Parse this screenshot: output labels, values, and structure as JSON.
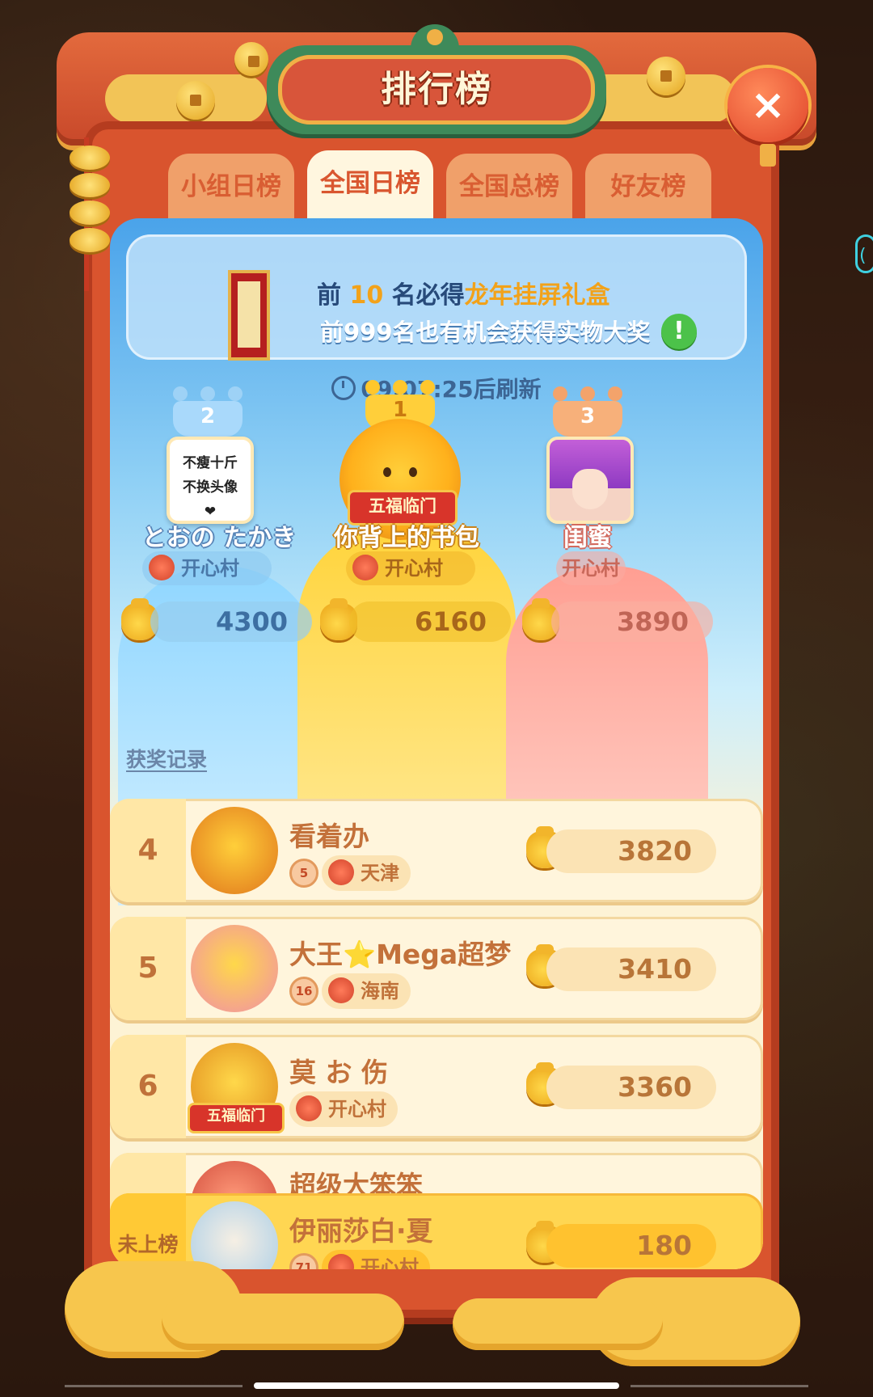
{
  "header": {
    "title": "排行榜",
    "close_label": "×"
  },
  "tabs": [
    {
      "label": "小组日榜",
      "active": false
    },
    {
      "label": "全国日榜",
      "active": true
    },
    {
      "label": "全国总榜",
      "active": false
    },
    {
      "label": "好友榜",
      "active": false
    }
  ],
  "banner": {
    "line1_prefix": "前",
    "line1_number": "10",
    "line1_mid": "名必得",
    "line1_prize": "龙年挂屏礼盒",
    "line2": "前999名也有机会获得实物大奖",
    "info_icon": "!"
  },
  "timer": {
    "text": "09:07:25后刷新"
  },
  "podium": [
    {
      "rank": "2",
      "name": "とおの たかき",
      "village": "开心村",
      "score": "4300",
      "avatar_text": "不瘦十斤 不换头像 ❤"
    },
    {
      "rank": "1",
      "name": "你背上的书包",
      "village": "开心村",
      "score": "6160",
      "ribbon": "五福临门"
    },
    {
      "rank": "3",
      "name": "闺蜜",
      "village": "开心村",
      "score": "3890"
    }
  ],
  "history_link": "获奖记录",
  "rows": [
    {
      "rank": "4",
      "name": "看着办",
      "level": "5",
      "location": "天津",
      "score": "3820"
    },
    {
      "rank": "5",
      "name": "大王⭐Mega超梦",
      "level": "16",
      "location": "海南",
      "score": "3410"
    },
    {
      "rank": "6",
      "name": "莫 お 伤",
      "location": "开心村",
      "score": "3360",
      "ribbon": "五福临门"
    },
    {
      "rank": "",
      "name": "超级大笨笨",
      "score": ""
    }
  ],
  "me": {
    "rank_label": "未上榜",
    "name": "伊丽莎白·夏",
    "level": "71",
    "location": "开心村",
    "score": "180"
  },
  "colors": {
    "frame_red": "#d9542e",
    "tab_active_bg": "#fff6df",
    "accent_gold": "#f2a21a",
    "rank_text": "#c0723a",
    "panel_blue": "#4aa3ea"
  },
  "icons": [
    "close-icon",
    "clock-icon",
    "info-icon",
    "crown-icon",
    "gold-bag-icon",
    "tiger-icon",
    "level-badge-icon"
  ]
}
